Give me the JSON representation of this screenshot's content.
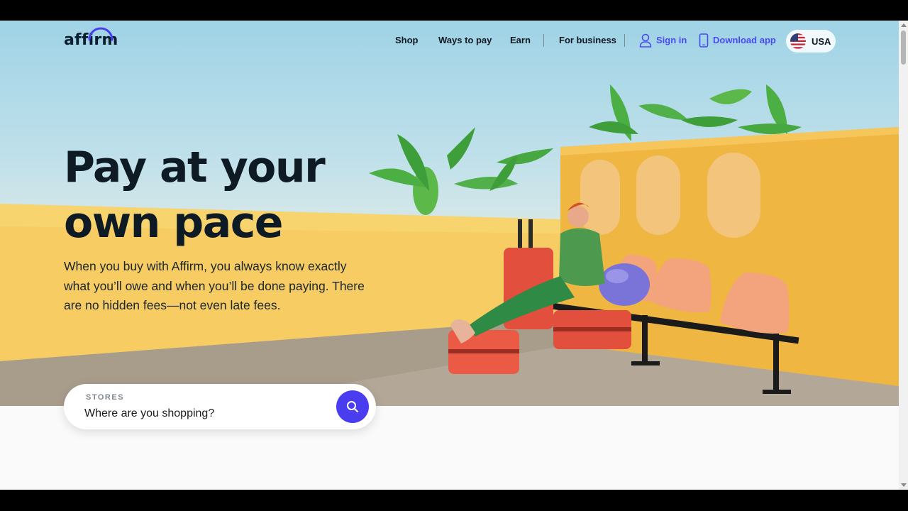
{
  "nav": {
    "logo": "affirm",
    "links": {
      "shop": "Shop",
      "ways_to_pay": "Ways to pay",
      "earn": "Earn",
      "for_business": "For business",
      "sign_in": "Sign in",
      "download_app": "Download app"
    },
    "country": "USA"
  },
  "hero": {
    "headline_line1": "Pay at your",
    "headline_line2": "own pace",
    "subtext": "When you buy with Affirm, you always know exactly what you’ll owe and when you’ll be done paying. There are no hidden fees—not even late fees."
  },
  "search": {
    "label": "STORES",
    "placeholder": "Where are you shopping?"
  },
  "colors": {
    "accent": "#4a3df0",
    "link": "#4a4af4",
    "text_dark": "#0e1b24"
  }
}
